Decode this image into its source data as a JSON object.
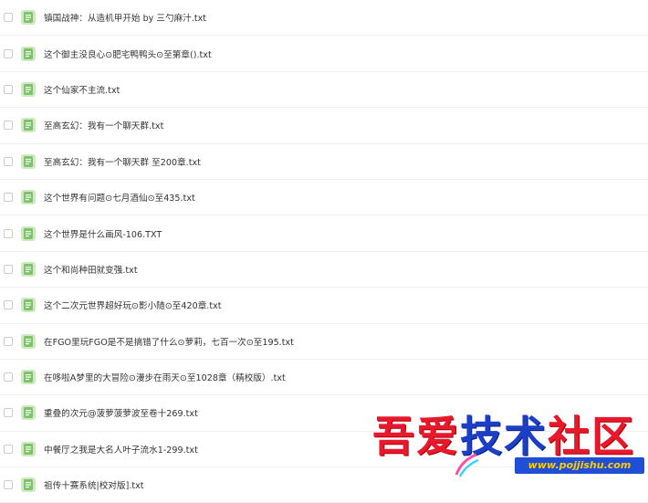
{
  "files": [
    {
      "name": "镇国战神：从造机甲开始 by 三勺麻汁.txt"
    },
    {
      "name": "这个御主没良心⊙肥宅鸭鸭头⊙至第章().txt"
    },
    {
      "name": "这个仙家不主流.txt"
    },
    {
      "name": "至高玄幻：我有一个聊天群.txt"
    },
    {
      "name": "至高玄幻：我有一个聊天群 至200章.txt"
    },
    {
      "name": "这个世界有问题⊙七月酒仙⊙至435.txt"
    },
    {
      "name": "这个世界是什么画风-106.TXT"
    },
    {
      "name": "这个和尚种田就变强.txt"
    },
    {
      "name": "这个二次元世界超好玩⊙影小随⊙至420章.txt"
    },
    {
      "name": "在FGO里玩FGO是不是搞错了什么⊙萝莉，七百一次⊙至195.txt"
    },
    {
      "name": "在哆啦A梦里的大冒险⊙漫步在雨天⊙至1028章（精校版）.txt"
    },
    {
      "name": "重叠的次元@菠萝菠萝波至卷十269.txt"
    },
    {
      "name": "中餐厅之我是大名人叶子流水1-299.txt"
    },
    {
      "name": "祖传十赛系统|校对版].txt"
    }
  ],
  "colors": {
    "file_icon": "#7ec36a",
    "watermark_red": "#e8192c",
    "watermark_blue": "#1c3fc8",
    "url_bg": "#1f4fd6",
    "url_text": "#ffcc00"
  },
  "watermark": {
    "text_red1": "吾爱",
    "text_blue": "技术",
    "text_red2": "社区",
    "url": "www.pojjishu.com"
  }
}
